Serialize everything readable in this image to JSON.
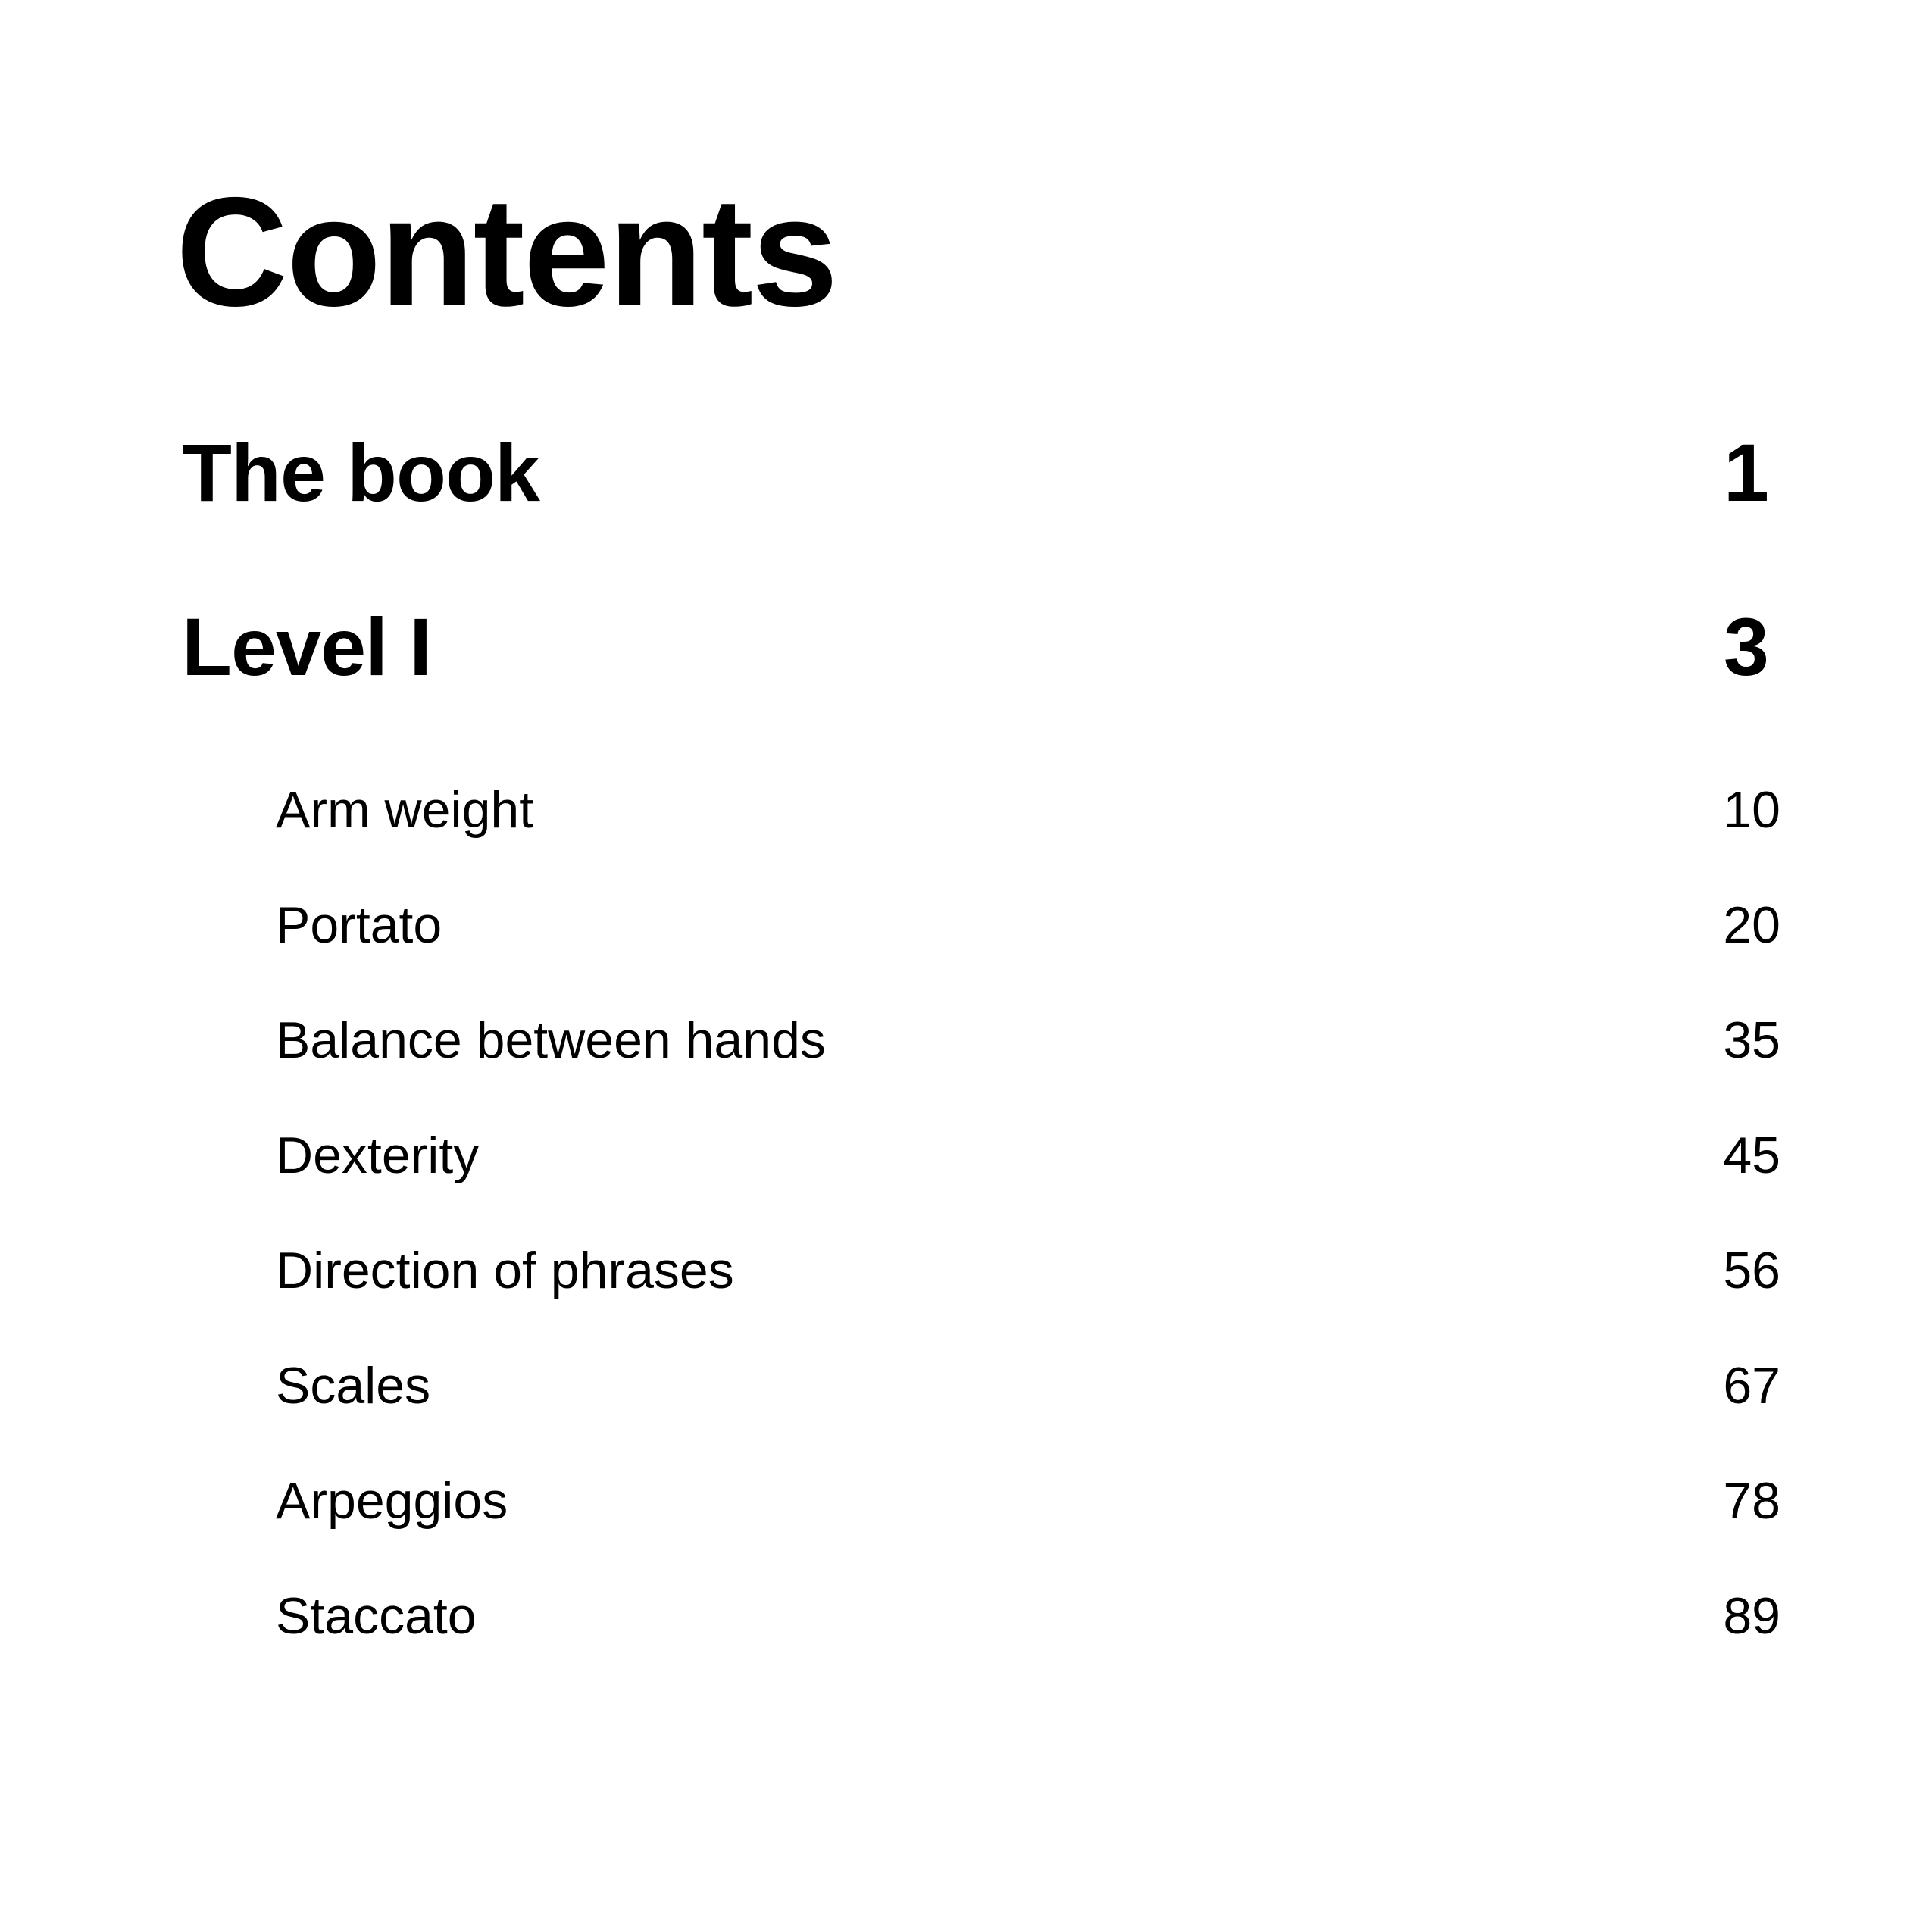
{
  "title": "Contents",
  "sections": [
    {
      "label": "The book",
      "page": "1"
    },
    {
      "label": "Level I",
      "page": "3"
    }
  ],
  "entries": [
    {
      "label": "Arm weight",
      "page": "10"
    },
    {
      "label": "Portato",
      "page": "20"
    },
    {
      "label": "Balance between hands",
      "page": "35"
    },
    {
      "label": "Dexterity",
      "page": "45"
    },
    {
      "label": "Direction of phrases",
      "page": "56"
    },
    {
      "label": "Scales",
      "page": "67"
    },
    {
      "label": "Arpeggios",
      "page": "78"
    },
    {
      "label": "Staccato",
      "page": "89"
    }
  ]
}
